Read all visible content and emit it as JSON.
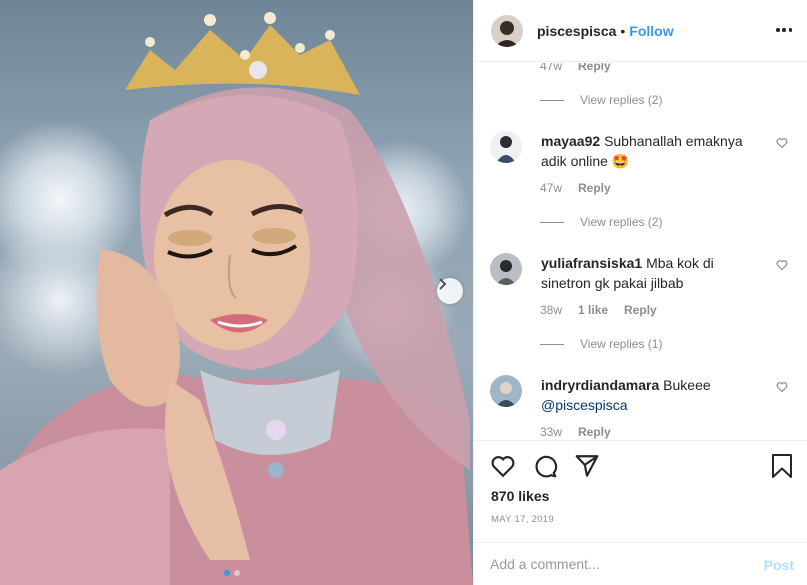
{
  "post": {
    "username": "piscespisca",
    "separator": "•",
    "follow_label": "Follow",
    "likes": "870 likes",
    "date": "MAY 17, 2019",
    "add_comment_placeholder": "Add a comment...",
    "post_label": "Post"
  },
  "comments": [
    {
      "type": "partial",
      "time": "47w",
      "reply": "Reply",
      "view_replies": "View replies (2)"
    },
    {
      "username": "mayaa92",
      "text": "Subhanallah emaknya adik online 🤩",
      "time": "47w",
      "likes": "",
      "reply": "Reply",
      "view_replies": "View replies (2)"
    },
    {
      "username": "yuliafransiska1",
      "text": "Mba kok di sinetron gk pakai jilbab",
      "time": "38w",
      "likes": "1 like",
      "reply": "Reply",
      "view_replies": "View replies (1)"
    },
    {
      "username": "indryrdiandamara",
      "text": "Bukeee",
      "mention": "@piscespisca",
      "time": "33w",
      "reply": "Reply"
    }
  ],
  "icons": {
    "heart": "heart-icon",
    "comment": "comment-icon",
    "share": "share-icon",
    "bookmark": "bookmark-icon",
    "more": "more-icon",
    "next": "chevron-right-icon"
  },
  "colors": {
    "accent": "#3897f0",
    "post_disabled": "#b2dffc"
  }
}
